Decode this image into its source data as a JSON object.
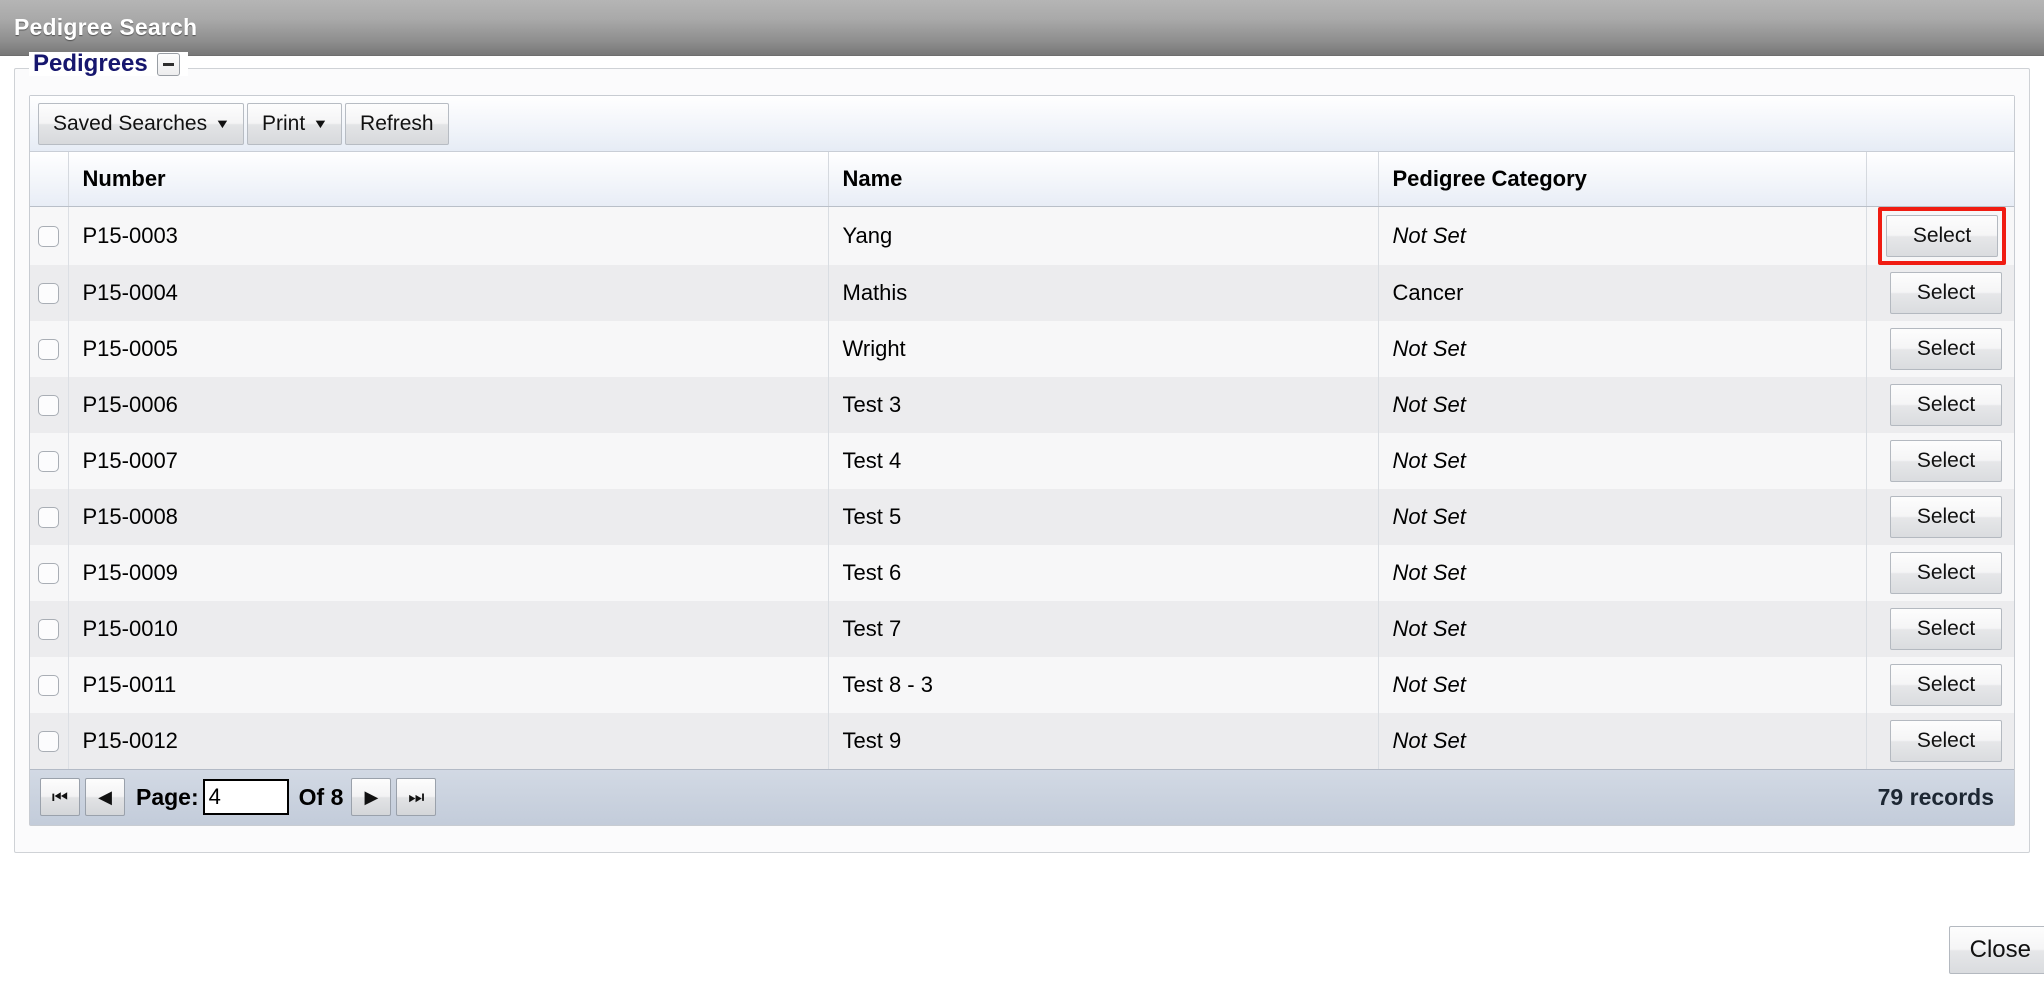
{
  "window": {
    "title": "Pedigree Search"
  },
  "panel": {
    "legend": "Pedigrees",
    "collapse_icon": "minus-icon"
  },
  "toolbar": {
    "saved_searches_label": "Saved Searches",
    "saved_searches_caret": "▼",
    "print_label": "Print",
    "print_caret": "▼",
    "refresh_label": "Refresh"
  },
  "table": {
    "columns": [
      {
        "key": "check",
        "label": ""
      },
      {
        "key": "number",
        "label": "Number"
      },
      {
        "key": "name",
        "label": "Name"
      },
      {
        "key": "cat",
        "label": "Pedigree Category"
      },
      {
        "key": "action",
        "label": ""
      }
    ],
    "action_label": "Select",
    "rows": [
      {
        "number": "P15-0003",
        "name": "Yang",
        "category": "Not Set",
        "category_italic": true,
        "action": "Select",
        "highlighted": true
      },
      {
        "number": "P15-0004",
        "name": "Mathis",
        "category": "Cancer",
        "category_italic": false,
        "action": "Select",
        "highlighted": false
      },
      {
        "number": "P15-0005",
        "name": "Wright",
        "category": "Not Set",
        "category_italic": true,
        "action": "Select",
        "highlighted": false
      },
      {
        "number": "P15-0006",
        "name": "Test 3",
        "category": "Not Set",
        "category_italic": true,
        "action": "Select",
        "highlighted": false
      },
      {
        "number": "P15-0007",
        "name": "Test 4",
        "category": "Not Set",
        "category_italic": true,
        "action": "Select",
        "highlighted": false
      },
      {
        "number": "P15-0008",
        "name": "Test 5",
        "category": "Not Set",
        "category_italic": true,
        "action": "Select",
        "highlighted": false
      },
      {
        "number": "P15-0009",
        "name": "Test 6",
        "category": "Not Set",
        "category_italic": true,
        "action": "Select",
        "highlighted": false
      },
      {
        "number": "P15-0010",
        "name": "Test 7",
        "category": "Not Set",
        "category_italic": true,
        "action": "Select",
        "highlighted": false
      },
      {
        "number": "P15-0011",
        "name": "Test 8 - 3",
        "category": "Not Set",
        "category_italic": true,
        "action": "Select",
        "highlighted": false
      },
      {
        "number": "P15-0012",
        "name": "Test 9",
        "category": "Not Set",
        "category_italic": true,
        "action": "Select",
        "highlighted": false
      }
    ]
  },
  "pager": {
    "first_icon": "⏮",
    "prev_icon": "◀",
    "next_icon": "▶",
    "last_icon": "⏭",
    "page_label": "Page:",
    "page_value": "4",
    "of_label": "Of 8",
    "records_label": "79 records"
  },
  "footer": {
    "close_label": "Close"
  },
  "colors": {
    "highlight": "#f01c12",
    "legend_text": "#16166e",
    "titlebar_text": "#ffffff"
  }
}
